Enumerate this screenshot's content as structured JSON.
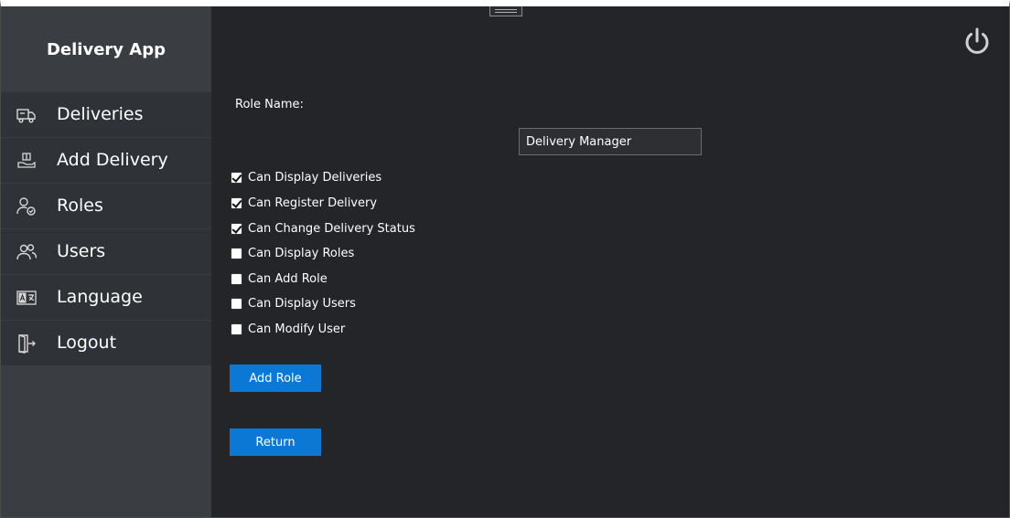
{
  "app": {
    "title": "Delivery App"
  },
  "nav": {
    "items": [
      {
        "label": "Deliveries",
        "icon": "truck-icon"
      },
      {
        "label": "Add Delivery",
        "icon": "add-delivery-icon"
      },
      {
        "label": "Roles",
        "icon": "user-role-icon"
      },
      {
        "label": "Users",
        "icon": "users-icon"
      },
      {
        "label": "Language",
        "icon": "language-icon"
      },
      {
        "label": "Logout",
        "icon": "logout-icon"
      }
    ]
  },
  "form": {
    "role_name_label": "Role Name:",
    "role_name_value": "Delivery Manager",
    "permissions": [
      {
        "label": "Can Display Deliveries",
        "checked": true
      },
      {
        "label": "Can Register Delivery",
        "checked": true
      },
      {
        "label": "Can Change Delivery Status",
        "checked": true
      },
      {
        "label": "Can Display Roles",
        "checked": false
      },
      {
        "label": "Can Add Role",
        "checked": false
      },
      {
        "label": "Can Display Users",
        "checked": false
      },
      {
        "label": "Can Modify User",
        "checked": false
      }
    ],
    "add_role_label": "Add Role",
    "return_label": "Return"
  },
  "header": {
    "power_icon": "power-icon"
  },
  "colors": {
    "sidebar": "#3a3d42",
    "nav": "#2f3237",
    "content": "#242528",
    "accent": "#0a78d4"
  }
}
